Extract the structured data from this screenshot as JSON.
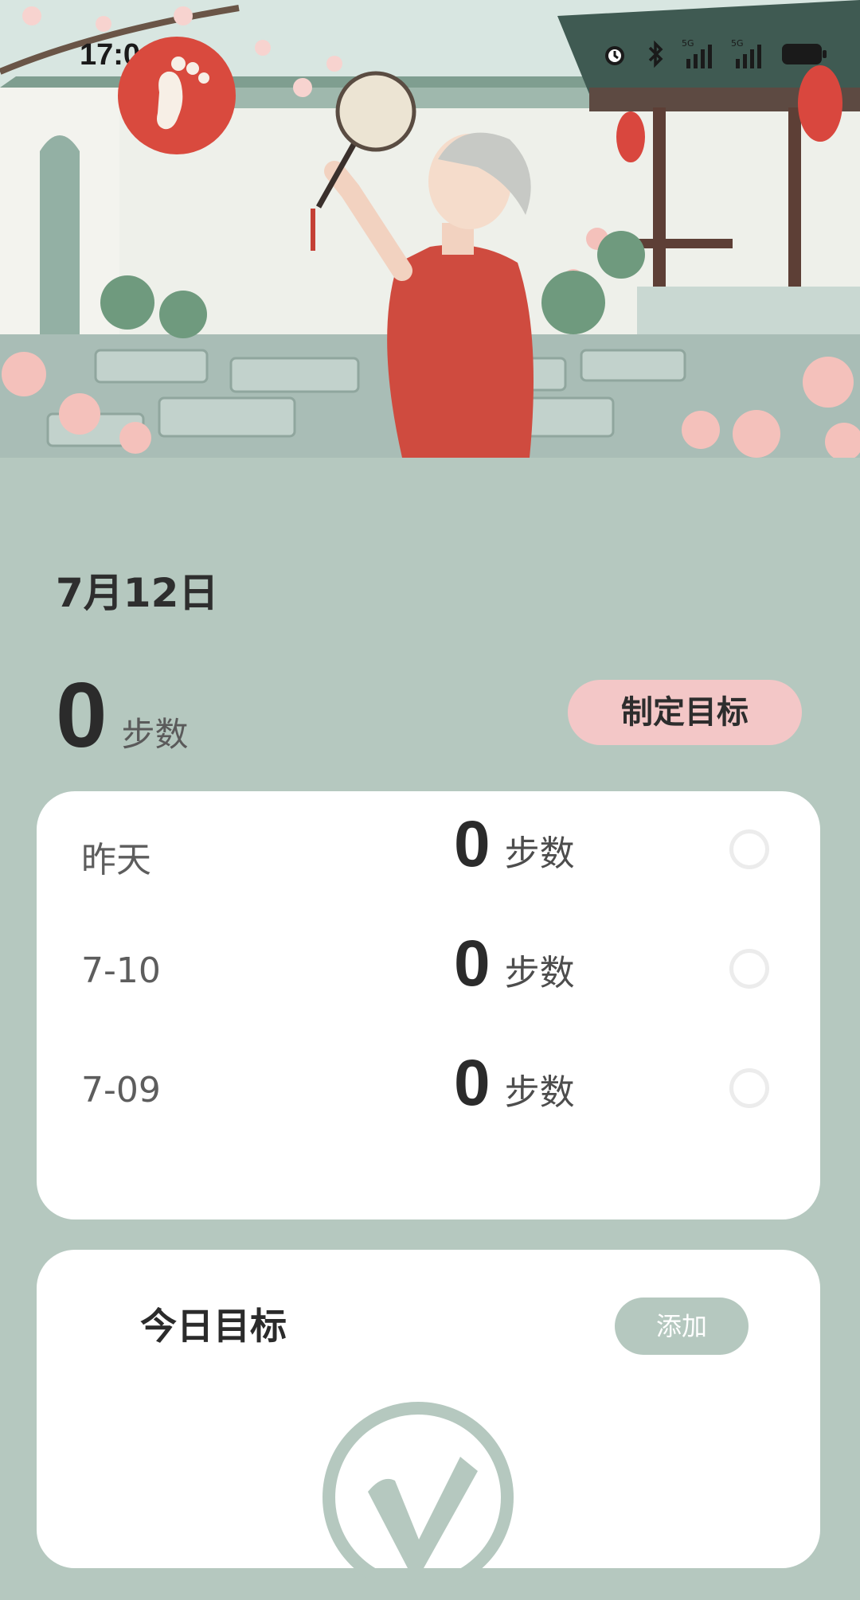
{
  "status_bar": {
    "time": "17:04",
    "icons": [
      "alarm-icon",
      "bluetooth-icon",
      "signal-5g-icon",
      "signal-5g-icon-2",
      "battery-icon"
    ]
  },
  "app": {
    "logo": "footprint-icon"
  },
  "today": {
    "date": "7月12日",
    "steps": "0",
    "unit": "步数",
    "set_goal_label": "制定目标"
  },
  "history": [
    {
      "label": "昨天",
      "steps": "0",
      "unit": "步数"
    },
    {
      "label": "7-10",
      "steps": "0",
      "unit": "步数"
    },
    {
      "label": "7-09",
      "steps": "0",
      "unit": "步数"
    }
  ],
  "goal_section": {
    "title": "今日目标",
    "add_label": "添加",
    "emblem": "check-badge-icon"
  },
  "colors": {
    "background": "#b5c8bf",
    "accent_pink": "#f3c7c7",
    "card": "#ffffff",
    "logo_red": "#d94a3e"
  }
}
